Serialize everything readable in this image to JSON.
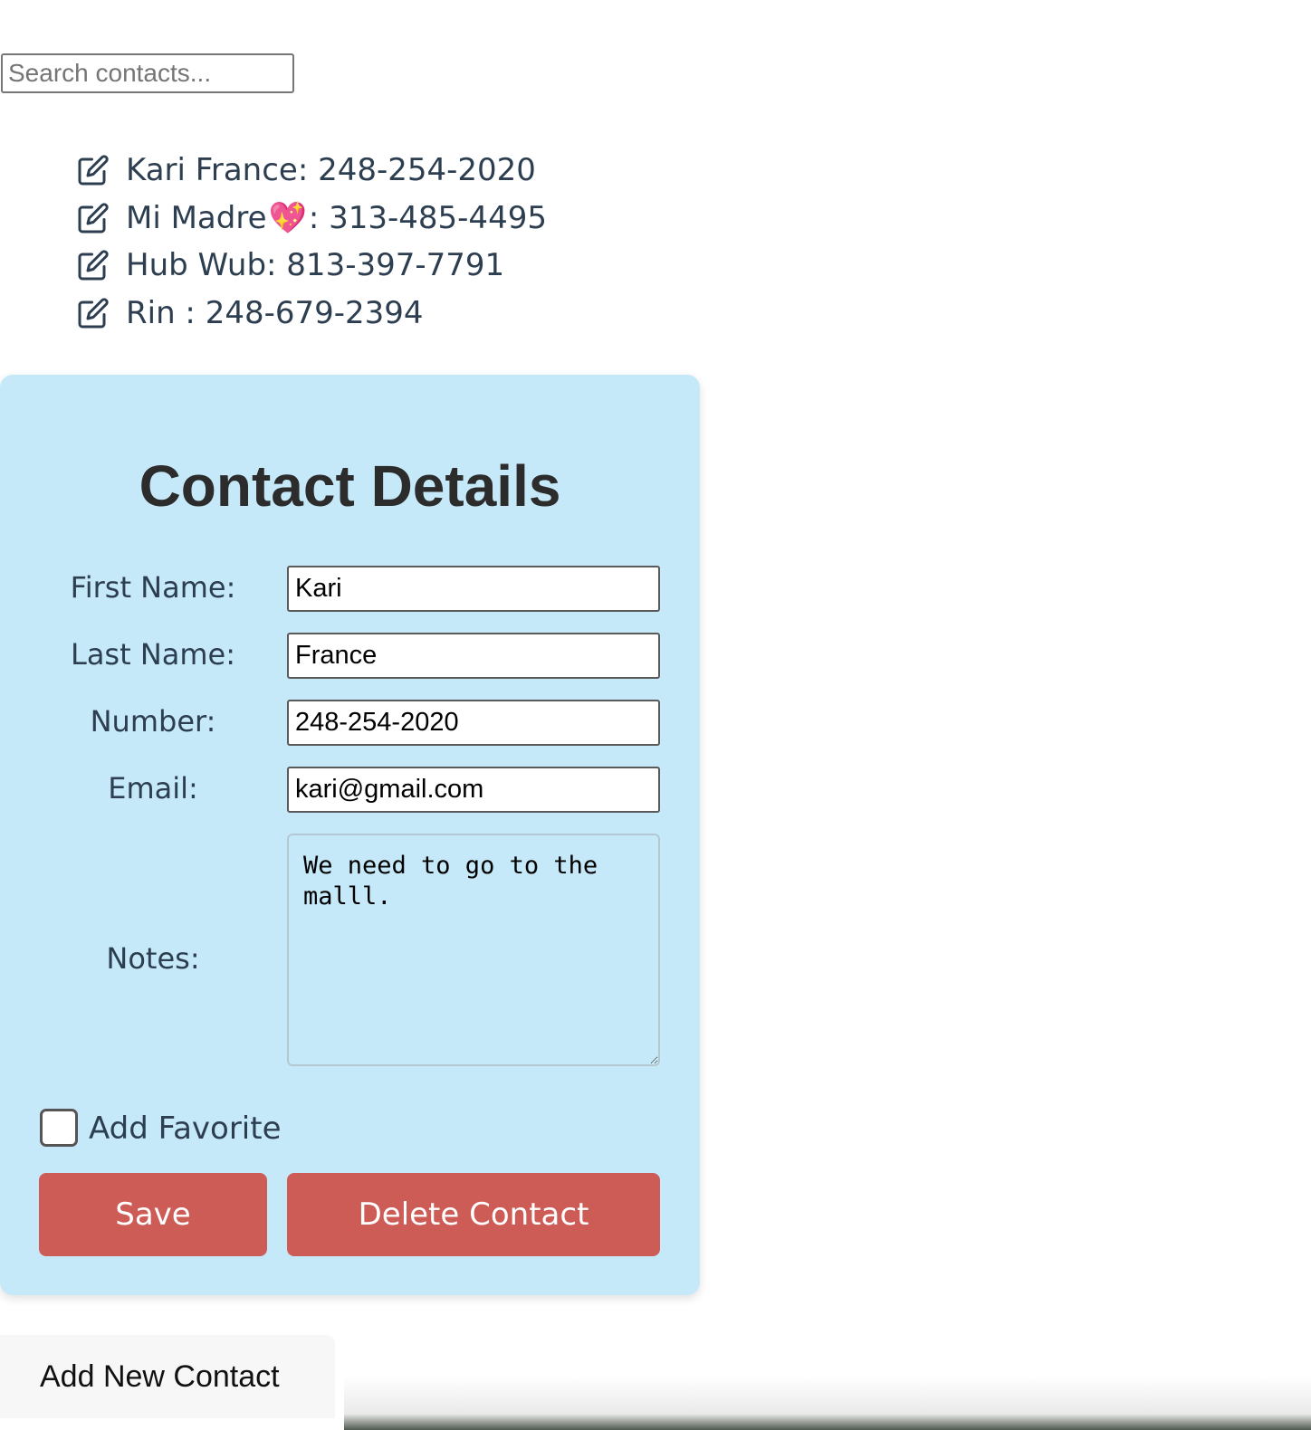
{
  "search": {
    "placeholder": "Search contacts..."
  },
  "contacts": [
    {
      "label_before_emoji": "Kari France: 248-254-2020",
      "emoji": "",
      "label_after_emoji": ""
    },
    {
      "label_before_emoji": "Mi Madre",
      "emoji": "💖",
      "label_after_emoji": ": 313-485-4495"
    },
    {
      "label_before_emoji": "Hub Wub: 813-397-7791",
      "emoji": "",
      "label_after_emoji": ""
    },
    {
      "label_before_emoji": "Rin : 248-679-2394",
      "emoji": "",
      "label_after_emoji": ""
    }
  ],
  "details": {
    "title": "Contact Details",
    "first_name_label": "First Name:",
    "first_name_value": "Kari",
    "last_name_label": "Last Name:",
    "last_name_value": "France",
    "number_label": "Number:",
    "number_value": "248-254-2020",
    "email_label": "Email:",
    "email_value": "kari@gmail.com",
    "notes_label": "Notes:",
    "notes_value": "We need to go to the malll.",
    "favorite_label": "Add Favorite",
    "favorite_checked": false,
    "save_label": "Save",
    "delete_label": "Delete Contact"
  },
  "add_new_label": "Add New Contact",
  "colors": {
    "panel_bg": "#c6e9f9",
    "button_bg": "#cd5c57",
    "text": "#2c3e50"
  },
  "icons": {
    "edit": "edit-pencil-square-icon"
  }
}
